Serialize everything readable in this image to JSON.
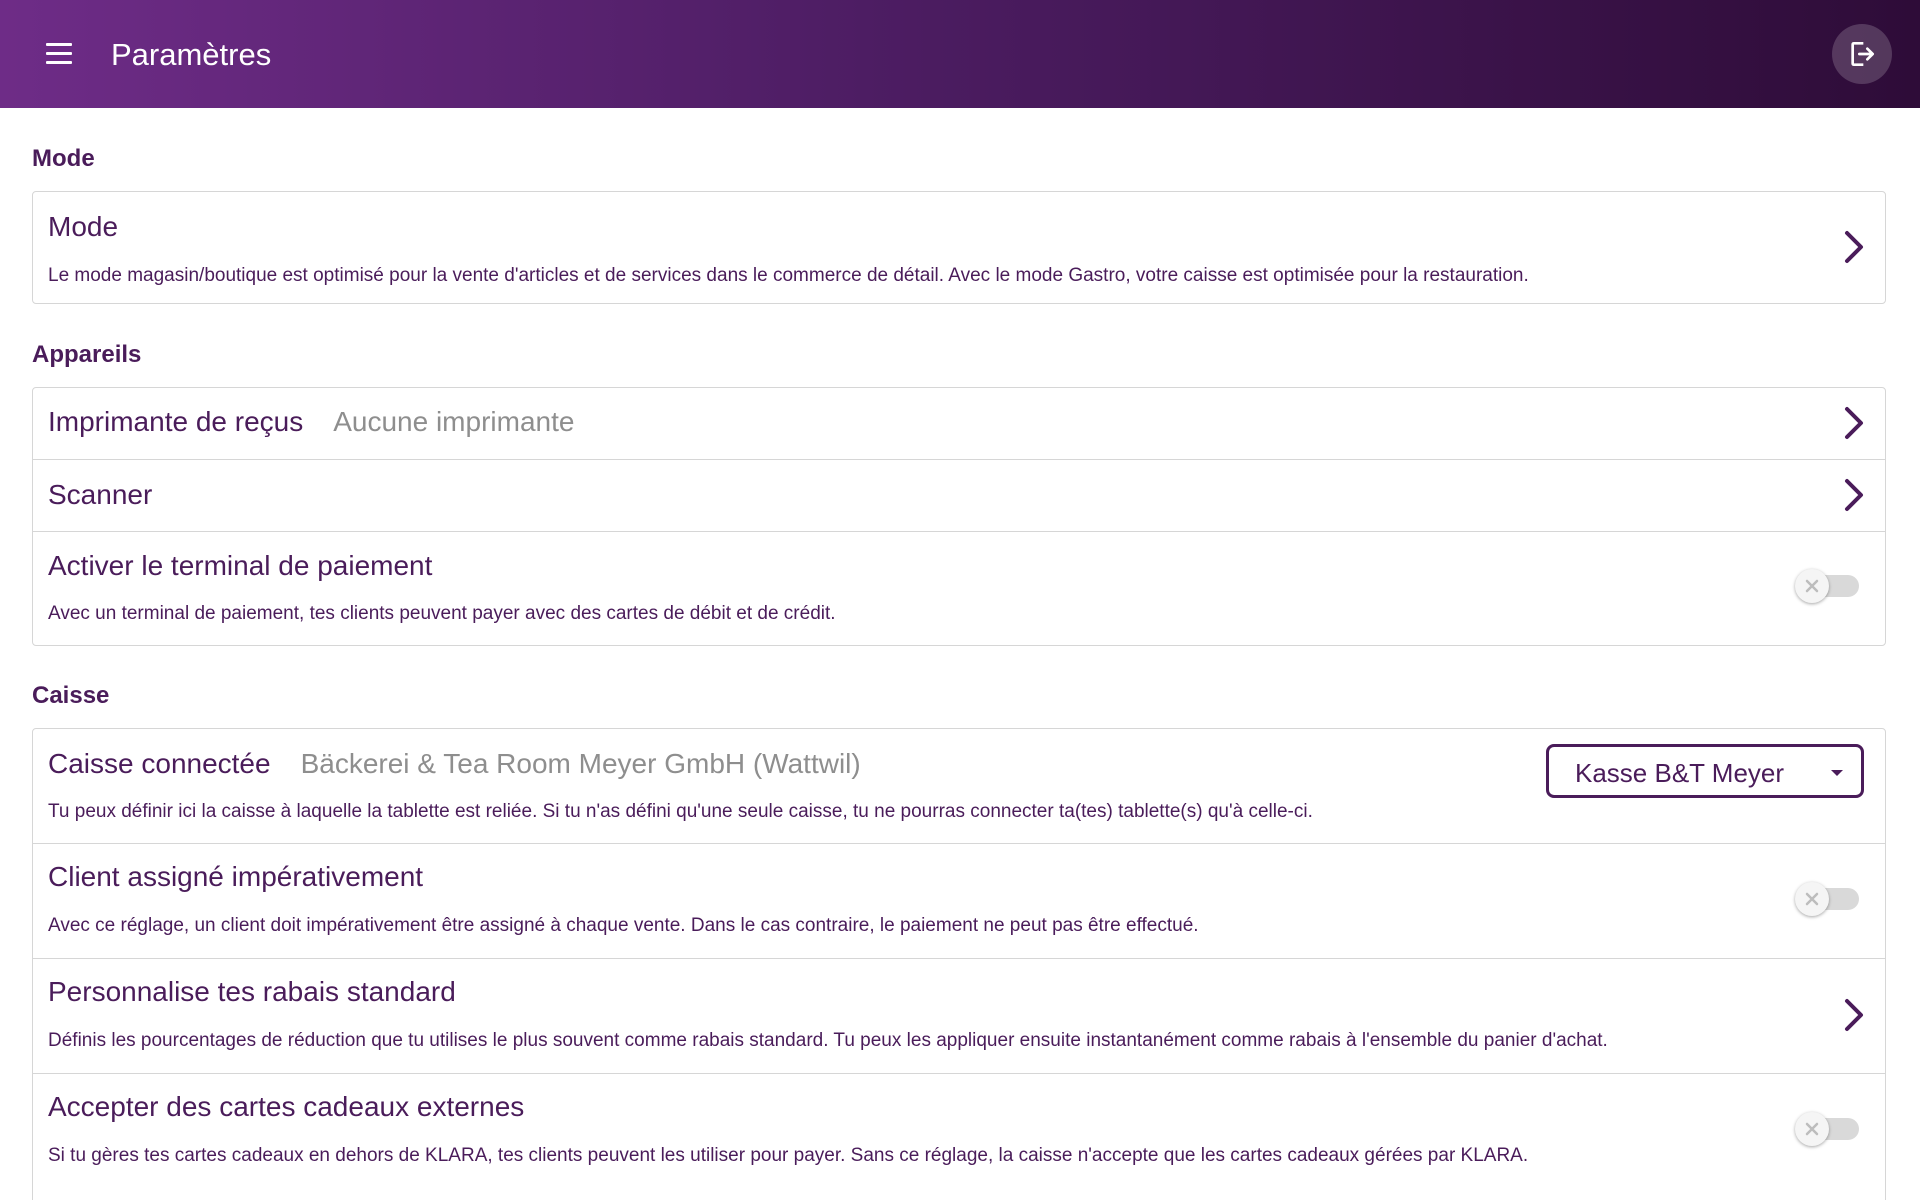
{
  "appbar": {
    "title": "Paramètres",
    "menu_icon": "hamburger-menu-icon",
    "logout_icon": "logout-icon"
  },
  "colors": {
    "primary": "#4a1c5a",
    "header_gradient_start": "#6e2c87",
    "header_gradient_end": "#2e0c38",
    "muted_text": "#8e8e8e",
    "divider": "#d6d6d6"
  },
  "sections": {
    "mode": {
      "title": "Mode",
      "items": [
        {
          "title": "Mode",
          "description": "Le mode magasin/boutique est optimisé pour la vente d'articles et de services dans le commerce de détail. Avec le mode Gastro, votre caisse est optimisée pour la restauration.",
          "control": "chevron-right-icon"
        }
      ]
    },
    "appareils": {
      "title": "Appareils",
      "items": [
        {
          "title": "Imprimante de reçus",
          "value": "Aucune imprimante",
          "control": "chevron-right-icon"
        },
        {
          "title": "Scanner",
          "control": "chevron-right-icon"
        },
        {
          "title": "Activer le terminal de paiement",
          "description": "Avec un terminal de paiement, tes clients peuvent payer avec des cartes de débit et de crédit.",
          "control": "toggle",
          "enabled": false
        }
      ]
    },
    "caisse": {
      "title": "Caisse",
      "items": [
        {
          "title": "Caisse connectée",
          "value": "Bäckerei & Tea Room Meyer GmbH (Wattwil)",
          "description": "Tu peux définir ici la caisse à laquelle la tablette est reliée. Si tu n'as défini qu'une seule caisse, tu ne pourras connecter ta(tes) tablette(s) qu'à celle-ci.",
          "control": "dropdown",
          "selected": "Kasse B&T Meyer"
        },
        {
          "title": "Client assigné impérativement",
          "description": "Avec ce réglage, un client doit impérativement être assigné à chaque vente. Dans le cas contraire, le paiement ne peut pas être effectué.",
          "control": "toggle",
          "enabled": false
        },
        {
          "title": "Personnalise tes rabais standard",
          "description": "Définis les pourcentages de réduction que tu utilises le plus souvent comme rabais standard. Tu peux les appliquer ensuite instantanément comme rabais à l'ensemble du panier d'achat.",
          "control": "chevron-right-icon"
        },
        {
          "title": "Accepter des cartes cadeaux externes",
          "description": "Si tu gères tes cartes cadeaux en dehors de KLARA, tes clients peuvent les utiliser pour payer. Sans ce réglage, la caisse n'accepte que les cartes cadeaux gérées par KLARA.",
          "control": "toggle",
          "enabled": false
        }
      ]
    }
  }
}
